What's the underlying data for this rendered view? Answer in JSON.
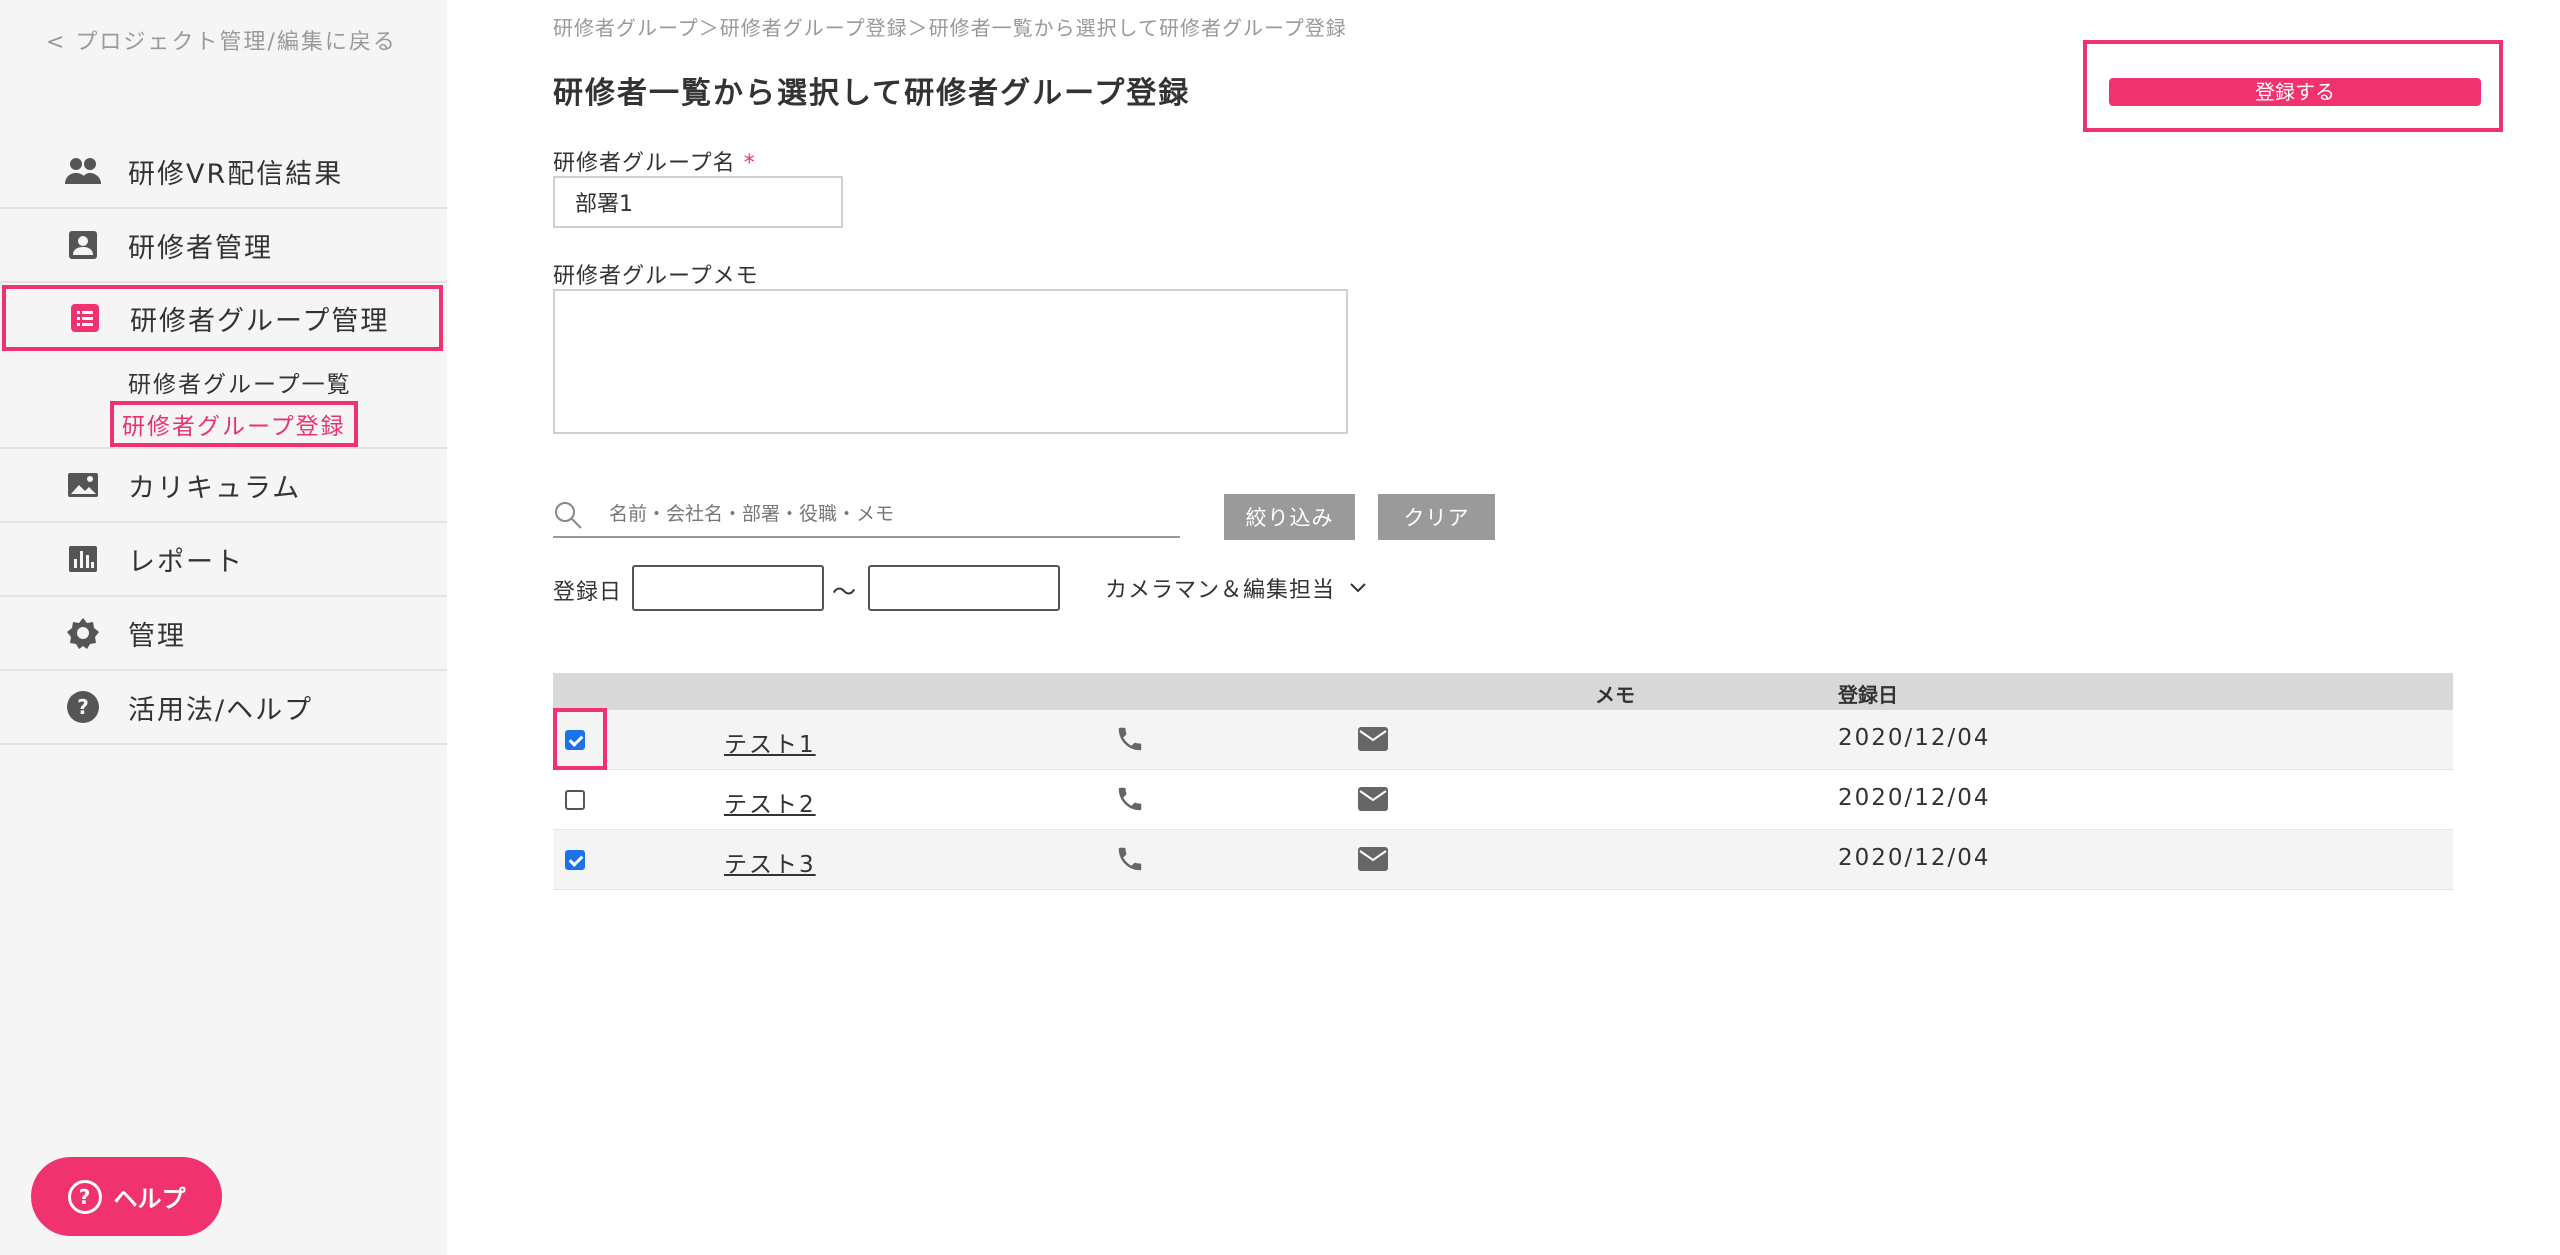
{
  "sidebar": {
    "back_label": "< プロジェクト管理/編集に戻る",
    "items": [
      {
        "label": "研修VR配信結果",
        "icon": "users-icon"
      },
      {
        "label": "研修者管理",
        "icon": "person-card-icon"
      },
      {
        "label": "研修者グループ管理",
        "icon": "list-icon"
      },
      {
        "label": "カリキュラム",
        "icon": "image-icon"
      },
      {
        "label": "レポート",
        "icon": "bar-chart-icon"
      },
      {
        "label": "管理",
        "icon": "gear-icon"
      },
      {
        "label": "活用法/ヘルプ",
        "icon": "question-circle-icon"
      }
    ],
    "sub_items": [
      {
        "label": "研修者グループ一覧"
      },
      {
        "label": "研修者グループ登録"
      }
    ],
    "help_label": "ヘルプ"
  },
  "header": {
    "breadcrumb": "研修者グループ＞研修者グループ登録＞研修者一覧から選択して研修者グループ登録",
    "title": "研修者一覧から選択して研修者グループ登録",
    "register_label": "登録する"
  },
  "form": {
    "group_name_label": "研修者グループ名",
    "required_mark": "*",
    "group_name_value": "部署1",
    "memo_label": "研修者グループメモ",
    "memo_value": ""
  },
  "filter": {
    "search_placeholder": "名前・会社名・部署・役職・メモ",
    "filter_label": "絞り込み",
    "clear_label": "クリア",
    "date_label": "登録日",
    "date_separator": "〜",
    "dropdown_label": "カメラマン＆編集担当"
  },
  "table": {
    "headers": {
      "memo": "メモ",
      "registered": "登録日"
    },
    "rows": [
      {
        "name": "テスト1",
        "date": "2020/12/04",
        "checked": true
      },
      {
        "name": "テスト2",
        "date": "2020/12/04",
        "checked": false
      },
      {
        "name": "テスト3",
        "date": "2020/12/04",
        "checked": true
      }
    ]
  },
  "colors": {
    "accent": "#f0336e",
    "checkbox": "#1a73e8",
    "gray_button": "#9a9a9a"
  }
}
